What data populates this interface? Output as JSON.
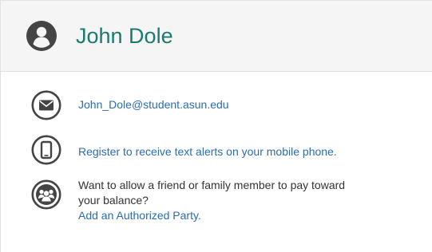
{
  "header": {
    "name": "John Dole",
    "avatar_icon": "user-circle-icon"
  },
  "contact": {
    "email": "John_Dole@student.asun.edu",
    "email_icon": "envelope-icon",
    "sms_link": "Register to receive text alerts on your mobile phone.",
    "sms_icon": "mobile-phone-icon",
    "authorized_prompt_line1": "Want to allow a friend or family member to pay toward",
    "authorized_prompt_line2": "your balance?",
    "authorized_link": "Add an Authorized Party.",
    "authorized_icon": "users-group-icon"
  },
  "colors": {
    "accent": "#1a7a70",
    "link": "#2a6db0",
    "icon": "#444444",
    "header_bg": "#f5f5f5"
  }
}
